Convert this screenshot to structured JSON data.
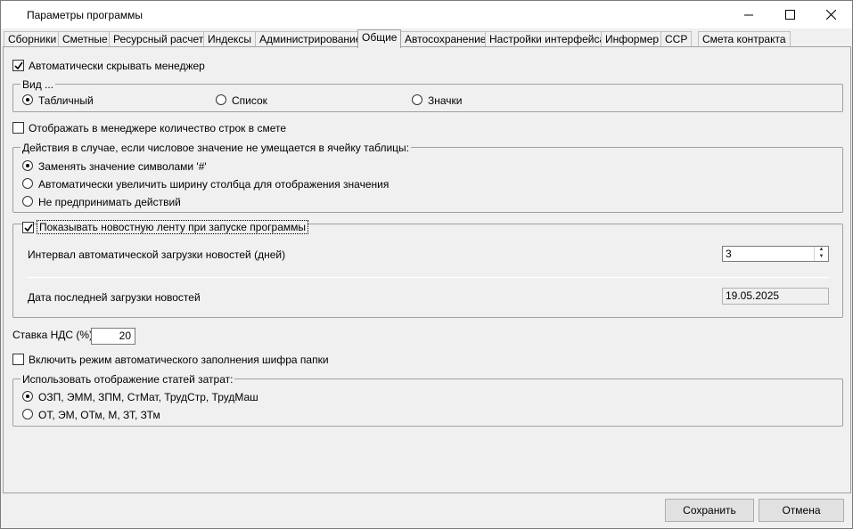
{
  "window": {
    "title": "Параметры программы"
  },
  "tabs": [
    {
      "label": "Сборники"
    },
    {
      "label": "Сметные"
    },
    {
      "label": "Ресурсный расчет"
    },
    {
      "label": "Индексы"
    },
    {
      "label": "Администрирование"
    },
    {
      "label": "Общие"
    },
    {
      "label": "Автосохранение"
    },
    {
      "label": "Настройки интерфейса"
    },
    {
      "label": "Информер"
    },
    {
      "label": "ССР"
    },
    {
      "label": "Смета контракта"
    }
  ],
  "active_tab": "Общие",
  "general": {
    "auto_hide_manager": {
      "label": "Автоматически скрывать менеджер",
      "checked": true
    },
    "view_group": {
      "label": "Вид ...",
      "options": [
        {
          "label": "Табличный",
          "selected": true
        },
        {
          "label": "Список",
          "selected": false
        },
        {
          "label": "Значки",
          "selected": false
        }
      ]
    },
    "show_row_count": {
      "label": "Отображать в менеджере количество строк в смете",
      "checked": false
    },
    "overflow_group": {
      "label": "Действия в случае, если числовое значение не умещается в ячейку таблицы:",
      "options": [
        {
          "label": "Заменять значение символами '#'",
          "selected": true
        },
        {
          "label": "Автоматически увеличить ширину столбца для отображения значения",
          "selected": false
        },
        {
          "label": "Не предпринимать действий",
          "selected": false
        }
      ]
    },
    "news_group": {
      "label": "Показывать новостную ленту при запуске программы",
      "checked": true,
      "interval_label": "Интервал автоматической загрузки новостей (дней)",
      "interval_value": "3",
      "last_date_label": "Дата последней загрузки новостей",
      "last_date_value": "19.05.2025"
    },
    "vat": {
      "label": "Ставка НДС (%)",
      "value": "20"
    },
    "auto_fill_code": {
      "label": "Включить режим автоматического заполнения шифра папки",
      "checked": false
    },
    "cost_items_group": {
      "label": "Использовать отображение статей затрат:",
      "options": [
        {
          "label": "ОЗП, ЭММ, ЗПМ, СтМат, ТрудСтр, ТрудМаш",
          "selected": true
        },
        {
          "label": "ОТ, ЭМ, ОТм, М, ЗТ, ЗТм",
          "selected": false
        }
      ]
    }
  },
  "footer": {
    "save_label": "Сохранить",
    "cancel_label": "Отмена"
  }
}
